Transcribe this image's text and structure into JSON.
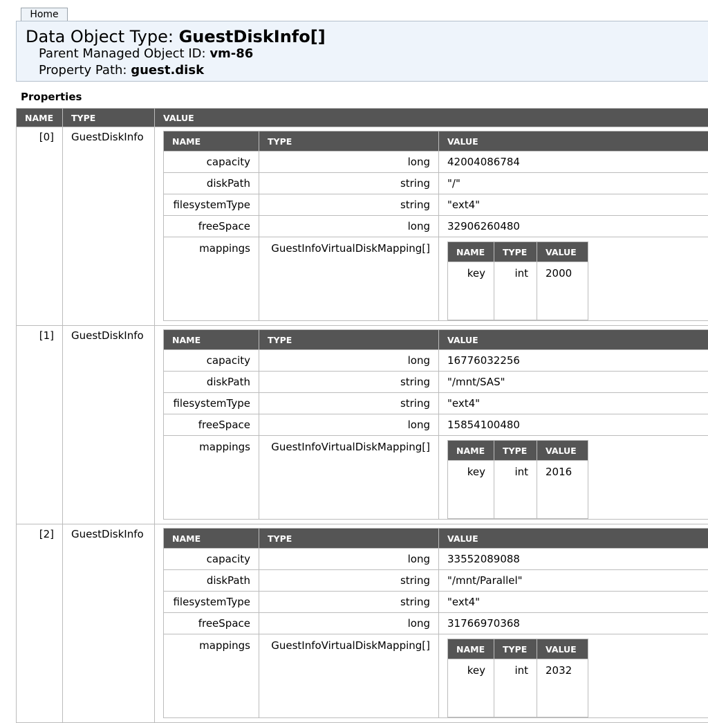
{
  "nav": {
    "home_label": "Home"
  },
  "header": {
    "type_label": "Data Object Type:",
    "type_value": "GuestDiskInfo[]",
    "parent_label": "Parent Managed Object ID:",
    "parent_value": "vm-86",
    "path_label": "Property Path:",
    "path_value": "guest.disk"
  },
  "properties_title": "Properties",
  "columns": {
    "name": "NAME",
    "type": "TYPE",
    "value": "VALUE"
  },
  "items": [
    {
      "index": "[0]",
      "type": "GuestDiskInfo",
      "capacity": "42004086784",
      "diskPath": "\"/\"",
      "filesystemType": "\"ext4\"",
      "freeSpace": "32906260480",
      "mapping_type": "GuestInfoVirtualDiskMapping[]",
      "mapping": {
        "name": "key",
        "type": "int",
        "value": "2000"
      }
    },
    {
      "index": "[1]",
      "type": "GuestDiskInfo",
      "capacity": "16776032256",
      "diskPath": "\"/mnt/SAS\"",
      "filesystemType": "\"ext4\"",
      "freeSpace": "15854100480",
      "mapping_type": "GuestInfoVirtualDiskMapping[]",
      "mapping": {
        "name": "key",
        "type": "int",
        "value": "2016"
      }
    },
    {
      "index": "[2]",
      "type": "GuestDiskInfo",
      "capacity": "33552089088",
      "diskPath": "\"/mnt/Parallel\"",
      "filesystemType": "\"ext4\"",
      "freeSpace": "31766970368",
      "mapping_type": "GuestInfoVirtualDiskMapping[]",
      "mapping": {
        "name": "key",
        "type": "int",
        "value": "2032"
      }
    }
  ],
  "field_names": {
    "capacity": "capacity",
    "diskPath": "diskPath",
    "filesystemType": "filesystemType",
    "freeSpace": "freeSpace",
    "mappings": "mappings"
  },
  "field_types": {
    "capacity": "long",
    "diskPath": "string",
    "filesystemType": "string",
    "freeSpace": "long"
  }
}
